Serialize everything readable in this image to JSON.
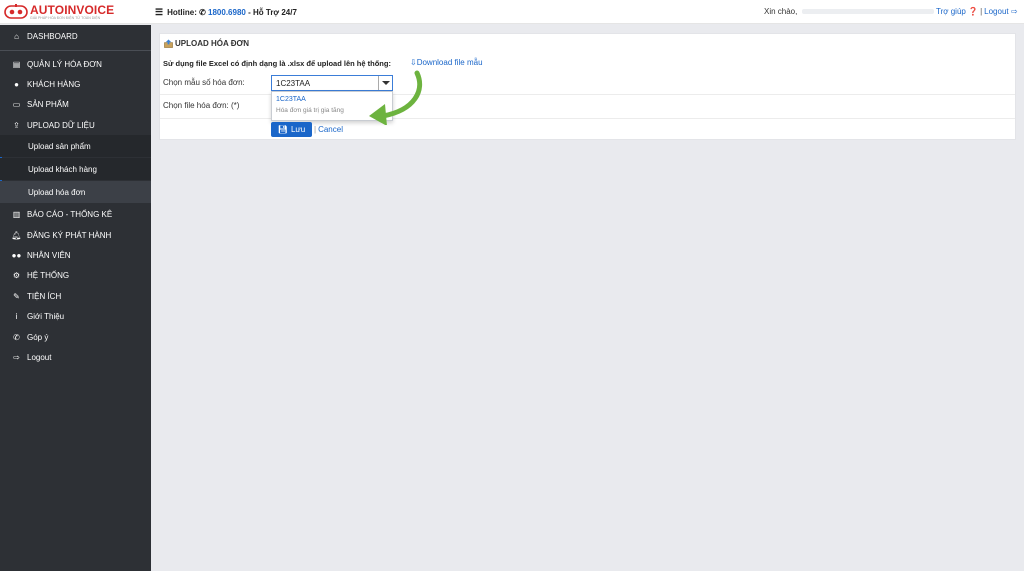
{
  "header": {
    "logo_auto": "AUTO",
    "logo_invoice": "INVOICE",
    "logo_tagline": "GIẢI PHÁP HÓA ĐƠN ĐIỆN TỬ TOÀN DIỆN",
    "hotline_label": "Hotline:",
    "hotline_number": "1800.6980",
    "hotline_suffix": "- Hỗ Trợ 24/7",
    "greeting": "Xin chào,",
    "help_label": "Trợ giúp",
    "logout_label": "Logout"
  },
  "sidebar": {
    "items": [
      {
        "label": "DASHBOARD",
        "icon": "home-icon"
      },
      {
        "label": "QUẢN LÝ HÓA ĐƠN",
        "icon": "file-icon"
      },
      {
        "label": "KHÁCH HÀNG",
        "icon": "user-icon"
      },
      {
        "label": "SẢN PHẨM",
        "icon": "folder-icon"
      },
      {
        "label": "UPLOAD DỮ LIỆU",
        "icon": "upload-icon"
      },
      {
        "label": "BÁO CÁO - THỐNG KÊ",
        "icon": "chart-icon"
      },
      {
        "label": "ĐĂNG KÝ PHÁT HÀNH",
        "icon": "bell-icon"
      },
      {
        "label": "NHÂN VIÊN",
        "icon": "users-icon"
      },
      {
        "label": "HỆ THỐNG",
        "icon": "cogs-icon"
      },
      {
        "label": "TIỆN ÍCH",
        "icon": "wrench-icon"
      },
      {
        "label": "Giới Thiệu",
        "icon": "info-icon"
      },
      {
        "label": "Góp ý",
        "icon": "phone-icon"
      },
      {
        "label": "Logout",
        "icon": "signout-icon"
      }
    ],
    "sub_items": [
      {
        "label": "Upload sản phẩm"
      },
      {
        "label": "Upload khách hàng"
      },
      {
        "label": "Upload hóa đơn"
      }
    ]
  },
  "main": {
    "title": "UPLOAD HÓA ĐƠN",
    "hint": "Sử dụng file Excel có định dạng là .xlsx để upload lên hệ thống:",
    "download_label": "Download file mẫu",
    "template_label": "Chọn mẫu số hóa đơn:",
    "template_value": "1C23TAA",
    "dropdown_option_code": "1C23TAA",
    "dropdown_option_desc": "Hóa đơn giá trị gia tăng",
    "file_label": "Chọn file hóa đơn: (*)",
    "save_label": "Lưu",
    "cancel_label": "Cancel"
  },
  "colors": {
    "sidebar_bg": "#2d3035",
    "accent": "#1a66c9",
    "brand_red": "#d62a2a",
    "annotation_arrow": "#6db33f"
  }
}
